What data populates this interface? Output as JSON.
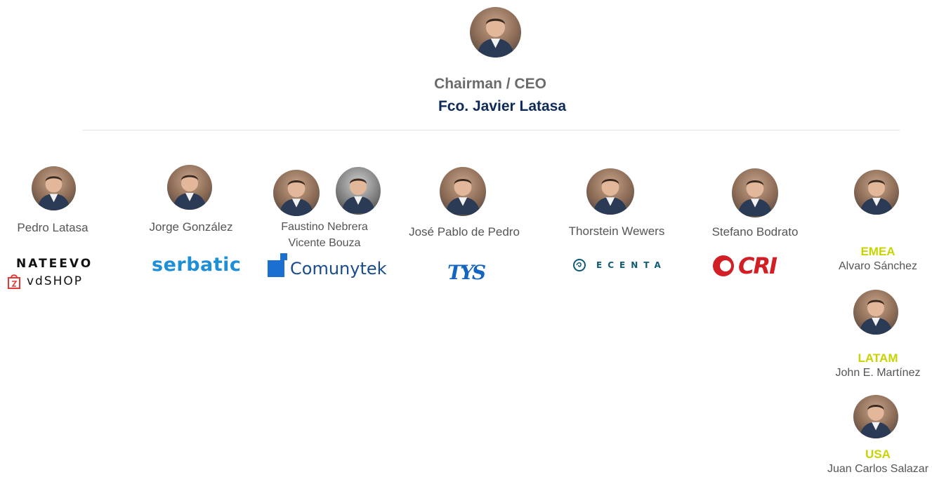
{
  "ceo": {
    "role": "Chairman / CEO",
    "name": "Fco. Javier Latasa"
  },
  "members": [
    {
      "name": "Pedro Latasa",
      "logos": [
        "NATEEVO",
        "vdSHOP"
      ]
    },
    {
      "name": "Jorge González",
      "logos": [
        "serbatic"
      ]
    },
    {
      "name": "Faustino Nebrera",
      "name2": "Vicente Bouza",
      "logos": [
        "Comunytek"
      ]
    },
    {
      "name": "José Pablo de Pedro",
      "logos": [
        "TYS"
      ]
    },
    {
      "name": "Thorstein Wewers",
      "logos": [
        "ECENTA"
      ]
    },
    {
      "name": "Stefano Bodrato",
      "logos": [
        "CRI"
      ]
    }
  ],
  "regions": [
    {
      "region": "EMEA",
      "name": "Alvaro Sánchez"
    },
    {
      "region": "LATAM",
      "name": "John E. Martínez"
    },
    {
      "region": "USA",
      "name": "Juan Carlos Salazar"
    }
  ],
  "colors": {
    "ceo_name": "#0e2a5a",
    "role": "#6b6b6b",
    "region": "#c8d400",
    "serbatic": "#1e8ed6",
    "comunytek": "#1a4b8c",
    "tys": "#1565c0",
    "ecenta": "#0f5a74",
    "cri": "#d21f26"
  }
}
